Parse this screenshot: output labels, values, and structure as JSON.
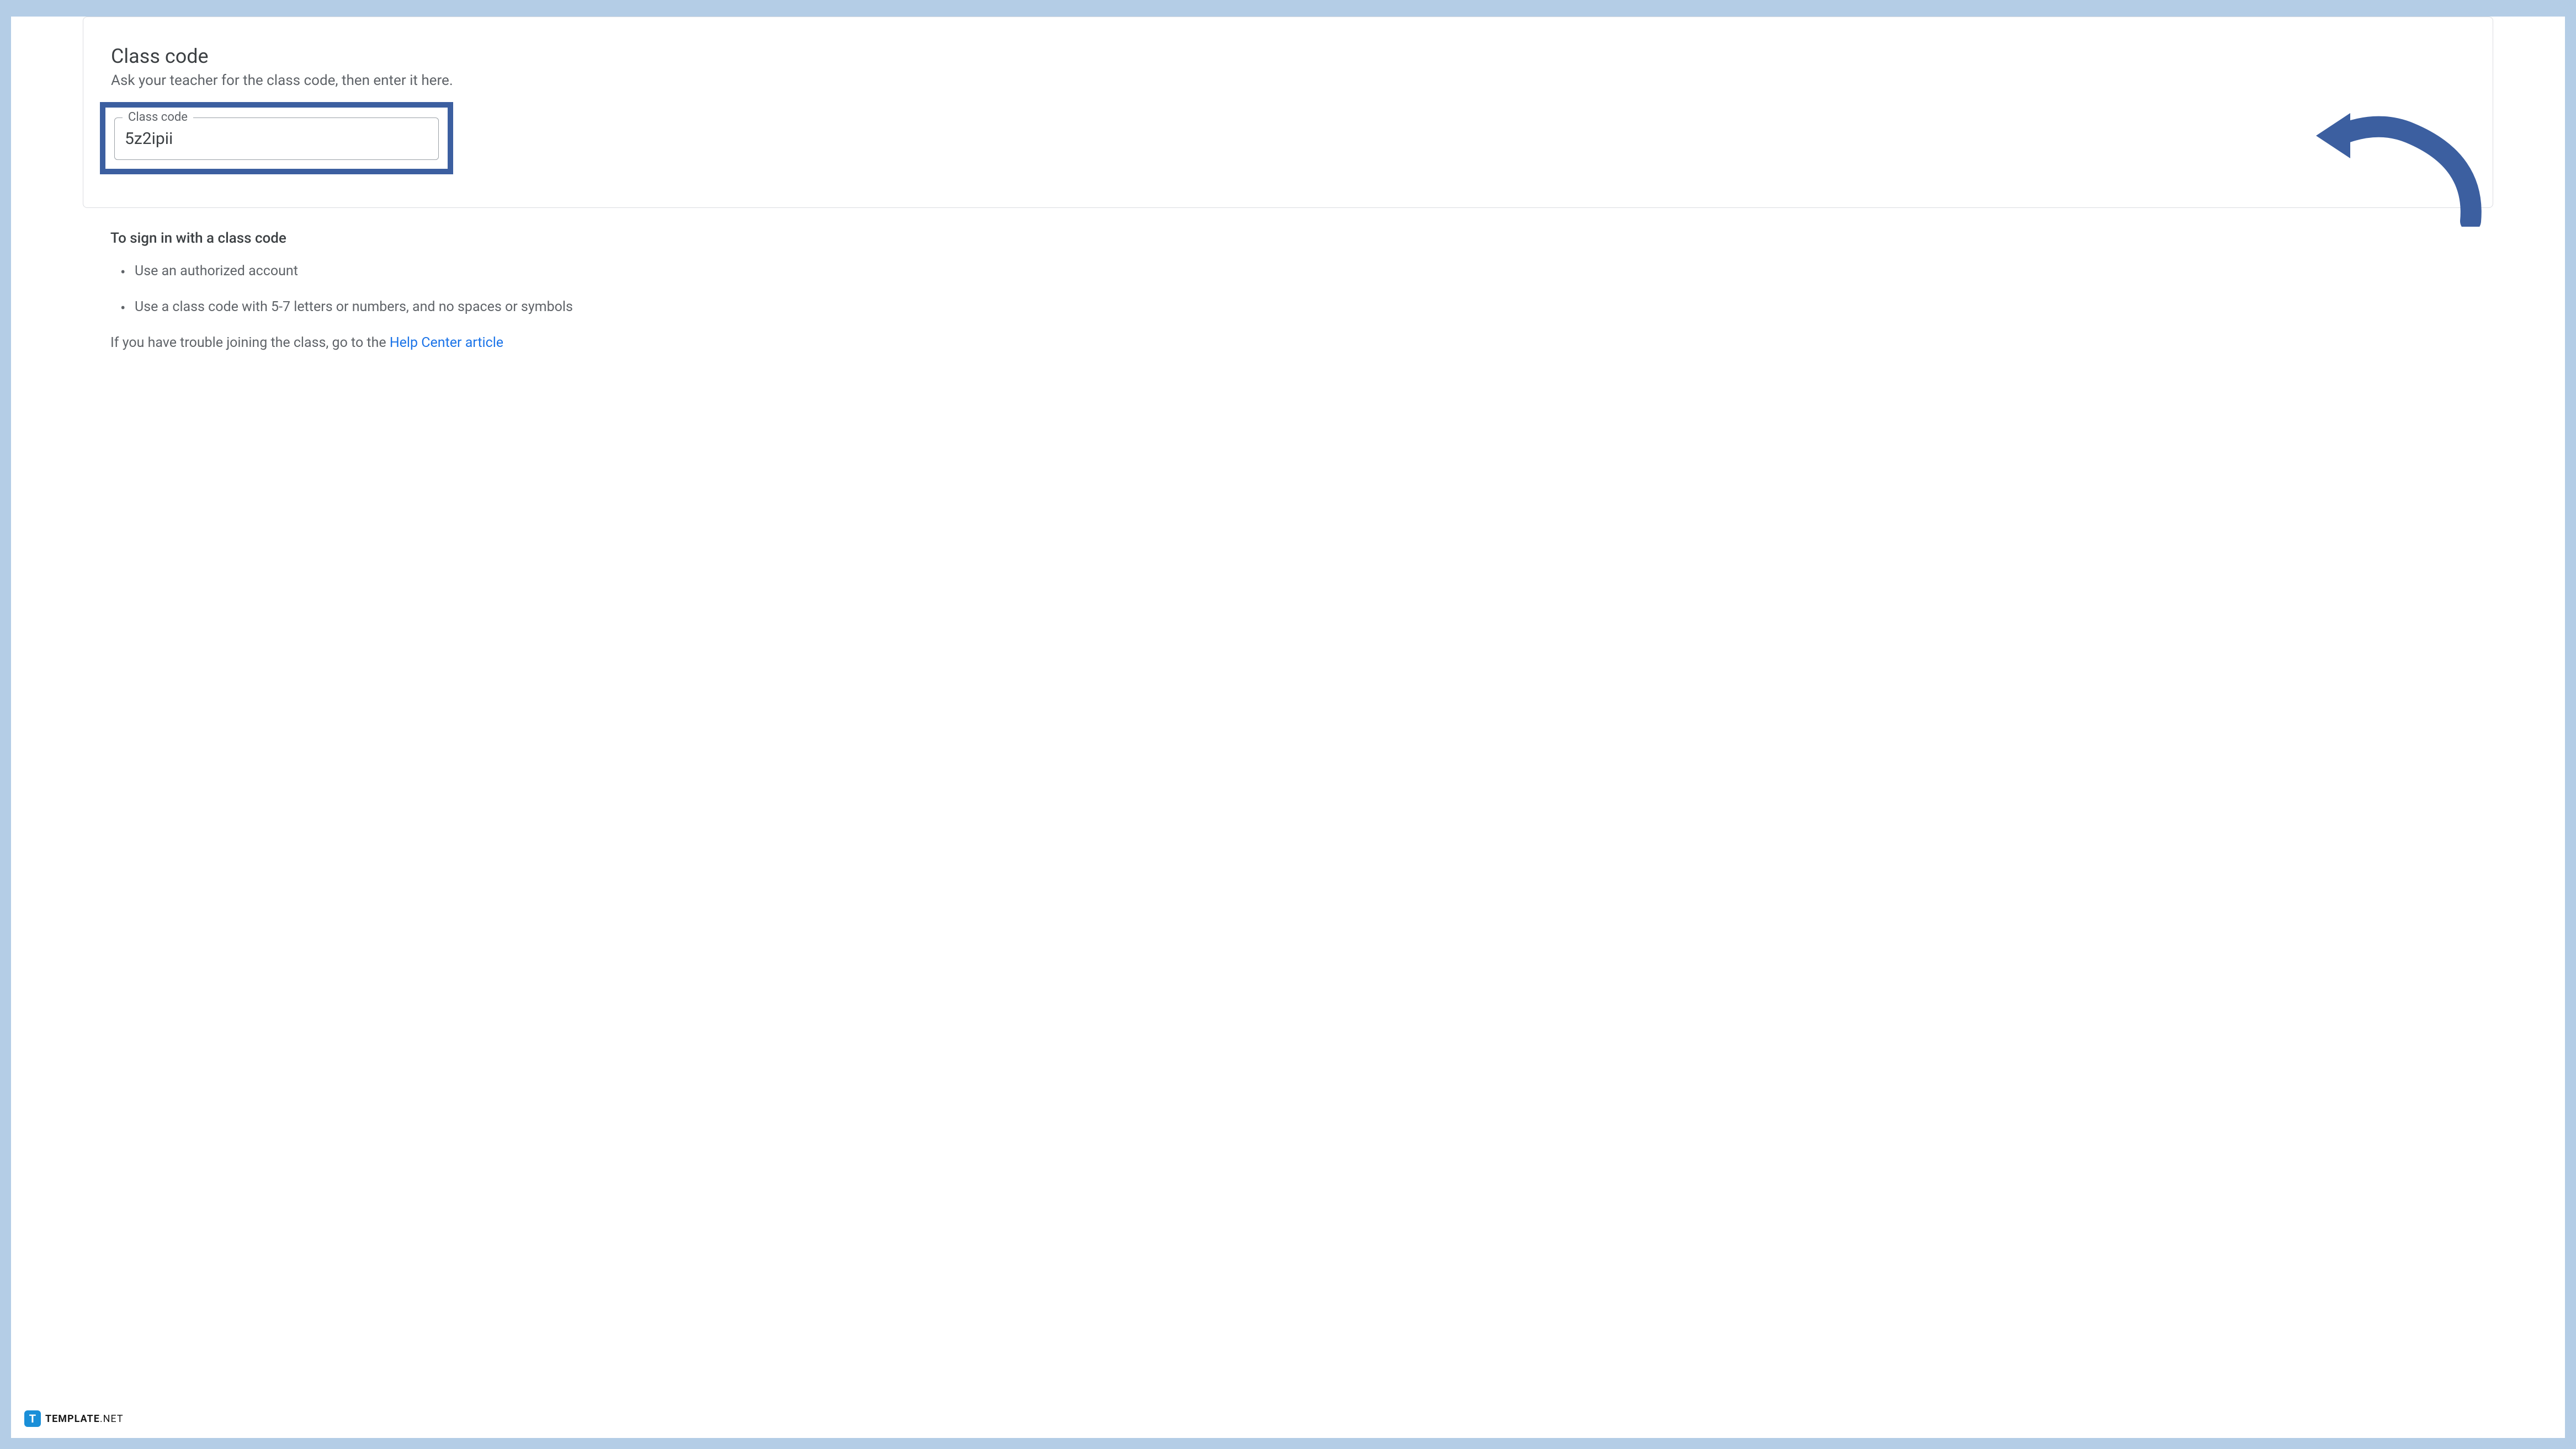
{
  "card": {
    "title": "Class code",
    "subtitle": "Ask your teacher for the class code, then enter it here.",
    "field_label": "Class code",
    "field_value": "5z2ipii"
  },
  "instructions": {
    "title": "To sign in with a class code",
    "items": [
      "Use an authorized account",
      "Use a class code with 5-7 letters or numbers, and no spaces or symbols"
    ],
    "help_prefix": "If you have trouble joining the class, go to the ",
    "help_link_text": "Help Center article"
  },
  "footer": {
    "badge": "T",
    "brand_bold": "TEMPLATE",
    "brand_light": ".NET"
  },
  "annotation": {
    "highlight_color": "#3c5fa0",
    "arrow_color": "#3c5fa0"
  }
}
